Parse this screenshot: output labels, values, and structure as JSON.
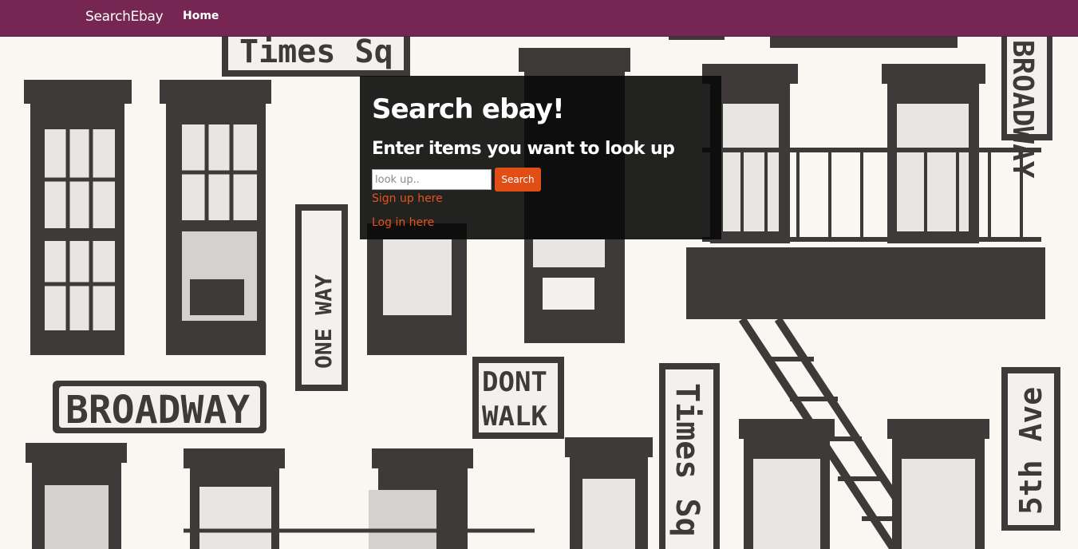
{
  "navbar": {
    "brand": "SearchEbay",
    "home_label": "Home",
    "background_color": "#762652"
  },
  "panel": {
    "title": "Search ebay!",
    "subtitle": "Enter items you want to look up",
    "search_placeholder": "look up..",
    "search_value": "",
    "search_button_label": "Search",
    "signup_link": "Sign up here",
    "login_link": "Log in here",
    "accent_color": "#e04e16"
  },
  "background": {
    "signs": [
      "Times Sq",
      "ONE WAY",
      "BROADWAY",
      "DONT",
      "WALK",
      "Times Sq",
      "5th Ave",
      "BROADWAY"
    ]
  }
}
